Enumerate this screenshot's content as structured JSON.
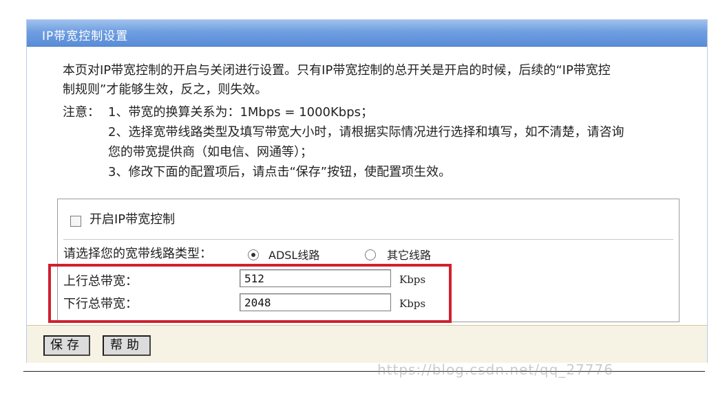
{
  "header": {
    "title": "IP带宽控制设置"
  },
  "description": {
    "line1": "本页对IP带宽控制的开启与关闭进行设置。只有IP带宽控制的总开关是开启的时候，后续的“IP带宽控",
    "line2": "制规则”才能够生效，反之，则失效。"
  },
  "notes": {
    "label": "注意：",
    "item1": "1、带宽的换算关系为：1Mbps = 1000Kbps；",
    "item2_line1": "2、选择宽带线路类型及填写带宽大小时，请根据实际情况进行选择和填写，如不清楚，请咨询",
    "item2_line2": "您的带宽提供商（如电信、网通等）；",
    "item3": "3、修改下面的配置项后，请点击“保存”按钮，使配置项生效。"
  },
  "form": {
    "enable_label": "开启IP带宽控制",
    "enable_checked": false,
    "line_type_label": "请选择您的宽带线路类型：",
    "line_options": [
      {
        "label": "ADSL线路",
        "selected": true
      },
      {
        "label": "其它线路",
        "selected": false
      }
    ],
    "upstream_label": "上行总带宽：",
    "upstream_value": "512",
    "upstream_unit": "Kbps",
    "downstream_label": "下行总带宽：",
    "downstream_value": "2048",
    "downstream_unit": "Kbps"
  },
  "buttons": {
    "save": "保存",
    "help": "帮助"
  },
  "watermark": "https://blog.csdn.net/qq_27776"
}
